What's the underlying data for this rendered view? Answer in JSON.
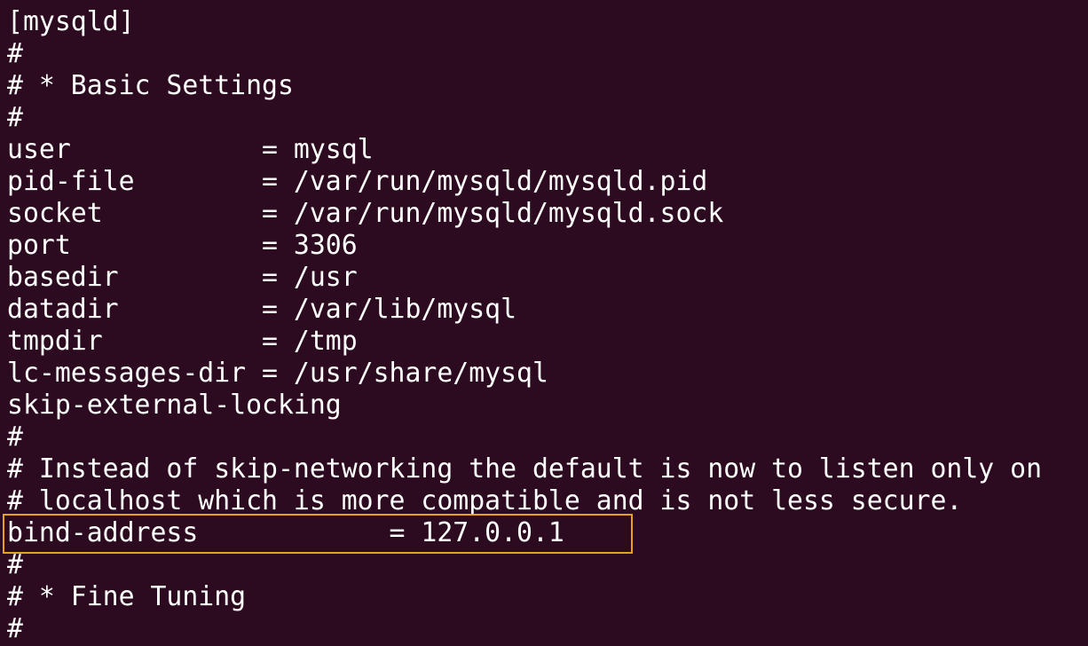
{
  "terminal": {
    "lines": [
      "[mysqld]",
      "#",
      "# * Basic Settings",
      "#",
      "user            = mysql",
      "pid-file        = /var/run/mysqld/mysqld.pid",
      "socket          = /var/run/mysqld/mysqld.sock",
      "port            = 3306",
      "basedir         = /usr",
      "datadir         = /var/lib/mysql",
      "tmpdir          = /tmp",
      "lc-messages-dir = /usr/share/mysql",
      "skip-external-locking",
      "#",
      "# Instead of skip-networking the default is now to listen only on",
      "# localhost which is more compatible and is not less secure.",
      "bind-address            = 127.0.0.1",
      "#",
      "# * Fine Tuning",
      "#",
      ""
    ],
    "highlighted_line_index": 16,
    "colors": {
      "background": "#2c0a20",
      "text": "#ffffff",
      "highlight_border": "#e8a21a"
    }
  }
}
